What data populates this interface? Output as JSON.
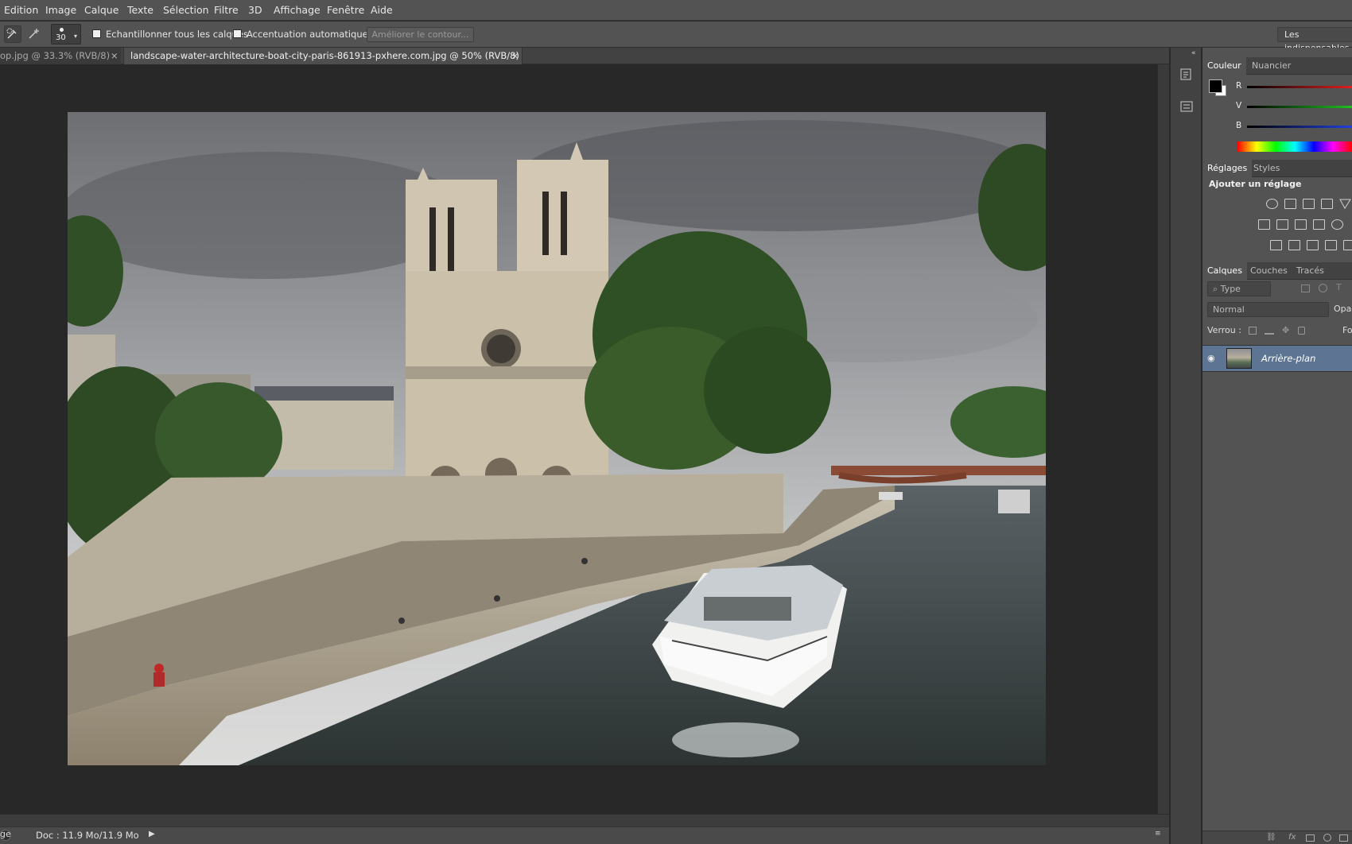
{
  "menu": [
    "Edition",
    "Image",
    "Calque",
    "Texte",
    "Sélection",
    "Filtre",
    "3D",
    "Affichage",
    "Fenêtre",
    "Aide"
  ],
  "options": {
    "brush_size": "30",
    "sample_all_layers": "Echantillonner tous les calques",
    "auto_enhance": "Accentuation automatique",
    "refine_edge": "Améliorer le contour...",
    "workspace": "Les indispensables"
  },
  "tabs": [
    {
      "label": "op.jpg @ 33.3% (RVB/8)",
      "close": "×",
      "active": false
    },
    {
      "label": "landscape-water-architecture-boat-city-paris-861913-pxhere.com.jpg @ 50% (RVB/8)",
      "close": "×",
      "active": true
    }
  ],
  "status": {
    "doc": "Doc : 11.9 Mo/11.9 Mo",
    "left_fragment": "ge"
  },
  "color_panel": {
    "tabs": [
      "Couleur",
      "Nuancier"
    ],
    "channels": [
      "R",
      "V",
      "B"
    ],
    "colors": {
      "fg": "#000000",
      "bg": "#ffffff",
      "r": "#d43a3a",
      "g": "#3fb43f",
      "b": "#3a5fd4"
    }
  },
  "adjust_panel": {
    "tabs": [
      "Réglages",
      "Styles"
    ],
    "title": "Ajouter un réglage"
  },
  "layers_panel": {
    "tabs": [
      "Calques",
      "Couches",
      "Tracés"
    ],
    "filter": "Type",
    "blend_mode": "Normal",
    "opacity_label": "Opac",
    "lock_label": "Verrou :",
    "fill_label": "Fo",
    "layers": [
      {
        "name": "Arrière-plan",
        "visible": true,
        "selected": true
      }
    ]
  }
}
